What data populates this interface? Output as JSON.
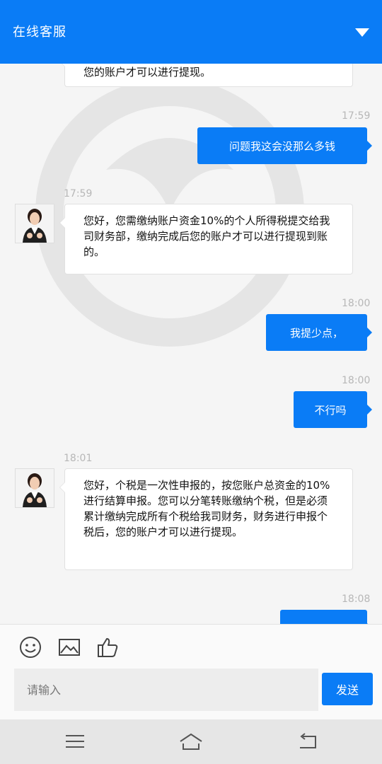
{
  "header": {
    "title": "在线客服"
  },
  "messages": [
    {
      "side": "left",
      "partial": true,
      "text": "您的账户才可以进行提现。"
    },
    {
      "side": "right",
      "time": "17:59",
      "text": "问题我这会没那么多钱"
    },
    {
      "side": "left",
      "time": "17:59",
      "text": "您好，您需缴纳账户资金10%的个人所得税提交给我司财务部，缴纳完成后您的账户才可以进行提现到账的。"
    },
    {
      "side": "right",
      "time": "18:00",
      "text": "我提少点，"
    },
    {
      "side": "right",
      "time": "18:00",
      "text": "不行吗"
    },
    {
      "side": "left",
      "time": "18:01",
      "text": "您好，个税是一次性申报的，按您账户总资金的10%进行结算申报。您可以分笔转账缴纳个税，但是必须累计缴纳完成所有个税给我司财务，财务进行申报个税后，您的账户才可以进行提现。"
    },
    {
      "side": "right",
      "time": "18:08",
      "partial": true,
      "text": ""
    }
  ],
  "toolbar": {
    "icons": [
      "emoji-icon",
      "image-icon",
      "thumbs-up-icon"
    ],
    "input_placeholder": "请输入",
    "send_label": "发送"
  },
  "colors": {
    "accent": "#0a7cf6",
    "background": "#f5f5f5"
  }
}
